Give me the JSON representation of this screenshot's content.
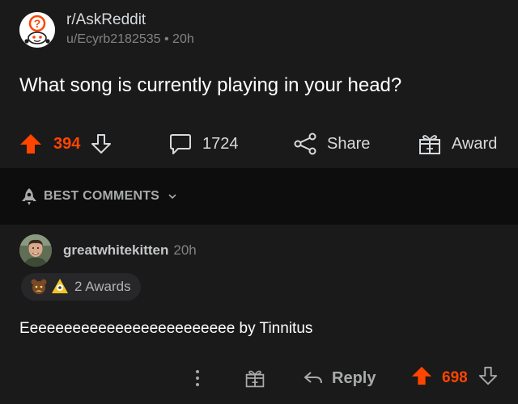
{
  "post": {
    "subreddit": "r/AskReddit",
    "author": "u/Ecyrb2182535",
    "separator": "•",
    "age": "20h",
    "title": "What song is currently playing in your head?",
    "upvotes": "394",
    "comments": "1724",
    "share_label": "Share",
    "award_label": "Award"
  },
  "sort": {
    "label": "BEST COMMENTS"
  },
  "comment": {
    "username": "greatwhitekitten",
    "age": "20h",
    "awards_label": "2 Awards",
    "body": "Eeeeeeeeeeeeeeeeeeeeeeeee by Tinnitus",
    "reply_label": "Reply",
    "score": "698"
  },
  "colors": {
    "accent": "#ff4500",
    "background": "#1a1a1b",
    "sort_bar": "#0d0d0e",
    "text_primary": "#ffffff",
    "text_secondary": "#818384"
  },
  "icons": {
    "subreddit_avatar": "askreddit-snoo-icon",
    "upvote": "arrow-up-icon",
    "downvote": "arrow-down-icon",
    "comment": "comment-bubble-icon",
    "share": "share-icon",
    "award": "gift-icon",
    "sort": "rocket-icon",
    "chevron": "chevron-down-icon",
    "more": "more-vertical-icon",
    "reply": "reply-arrow-icon"
  }
}
